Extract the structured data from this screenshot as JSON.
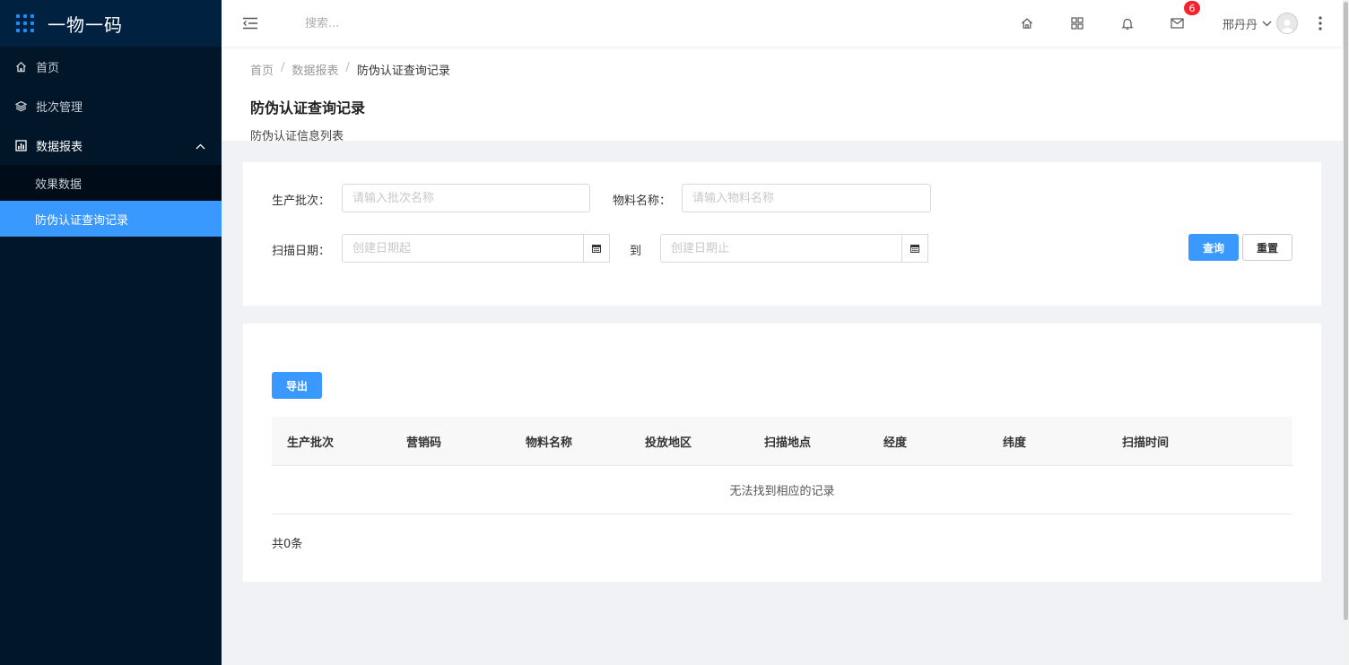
{
  "app": {
    "title": "一物一码"
  },
  "sidebar": {
    "items": [
      {
        "label": "首页",
        "icon": "home-icon"
      },
      {
        "label": "批次管理",
        "icon": "layers-icon"
      },
      {
        "label": "数据报表",
        "icon": "bar-chart-icon",
        "expanded": true
      }
    ],
    "subitems": [
      {
        "label": "效果数据",
        "active": false
      },
      {
        "label": "防伪认证查询记录",
        "active": true
      }
    ]
  },
  "header": {
    "search_placeholder": "搜索...",
    "mail_badge": "6",
    "user_name": "邢丹丹"
  },
  "breadcrumb": {
    "home": "首页",
    "parent": "数据报表",
    "current": "防伪认证查询记录",
    "separator": "/"
  },
  "page": {
    "title": "防伪认证查询记录",
    "description": "防伪认证信息列表"
  },
  "filter": {
    "batch_label": "生产批次：",
    "batch_placeholder": "请输入批次名称",
    "material_label": "物料名称：",
    "material_placeholder": "请输入物料名称",
    "date_label": "扫描日期：",
    "date_start_placeholder": "创建日期起",
    "date_to": "到",
    "date_end_placeholder": "创建日期止",
    "query_button": "查询",
    "reset_button": "重置"
  },
  "table": {
    "export_button": "导出",
    "columns": [
      "生产批次",
      "营销码",
      "物料名称",
      "投放地区",
      "扫描地点",
      "经度",
      "纬度",
      "扫描时间"
    ],
    "empty_text": "无法找到相应的记录",
    "total_text": "共0条"
  },
  "colors": {
    "primary": "#3a99ff",
    "sidebar_bg": "#011628",
    "badge": "#f5222d"
  }
}
